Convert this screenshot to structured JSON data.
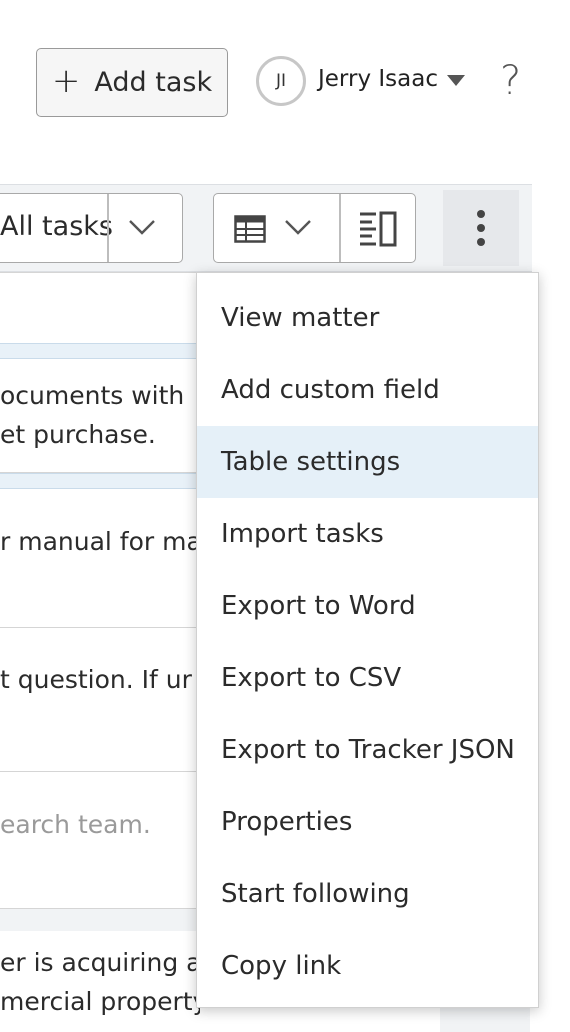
{
  "header": {
    "add_task_label": "Add task",
    "user_initials": "JI",
    "user_name": "Jerry Isaac",
    "help_label": "?"
  },
  "toolbar": {
    "filter_label": "All tasks"
  },
  "table": {
    "rows": [
      {
        "line1": "ocuments with",
        "line2": "et purchase."
      },
      {
        "line1": "r manual for ma",
        "line2": ""
      },
      {
        "line1": "t question. If ur",
        "line2": ""
      },
      {
        "line1": "earch team.",
        "line2": ""
      },
      {
        "line1": "er is acquiring a",
        "line2": "mercial property."
      }
    ]
  },
  "menu": {
    "items": [
      {
        "label": "View matter",
        "active": false
      },
      {
        "label": "Add custom field",
        "active": false
      },
      {
        "label": "Table settings",
        "active": true
      },
      {
        "label": "Import tasks",
        "active": false
      },
      {
        "label": "Export to Word",
        "active": false
      },
      {
        "label": "Export to CSV",
        "active": false
      },
      {
        "label": "Export to Tracker JSON",
        "active": false
      },
      {
        "label": "Properties",
        "active": false
      },
      {
        "label": "Start following",
        "active": false
      },
      {
        "label": "Copy link",
        "active": false
      }
    ]
  }
}
